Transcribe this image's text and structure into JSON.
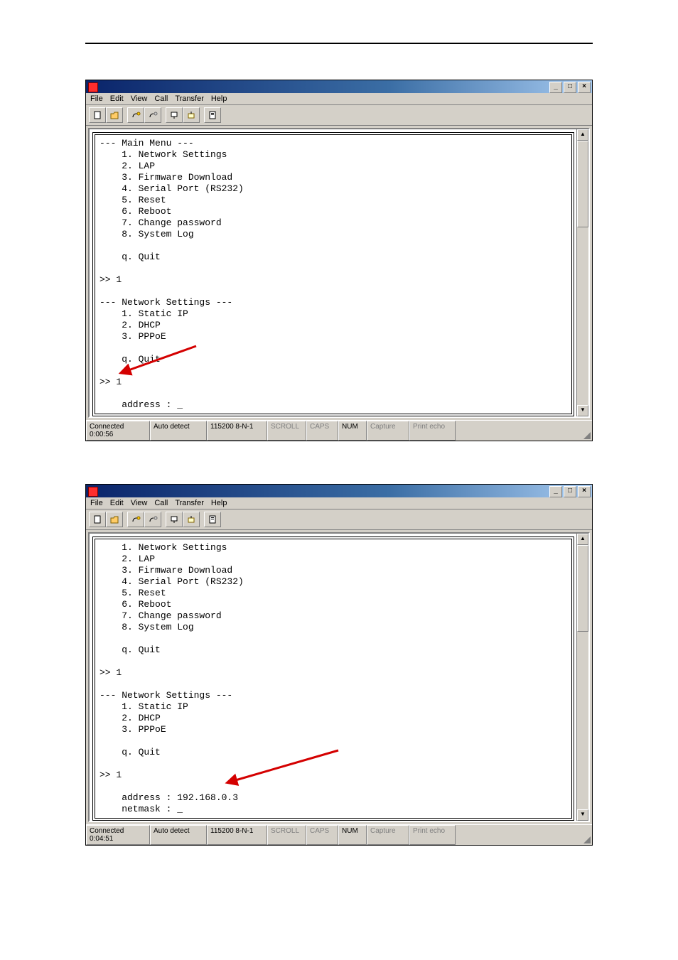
{
  "menu": {
    "file": "File",
    "edit": "Edit",
    "view": "View",
    "call": "Call",
    "transfer": "Transfer",
    "help": "Help"
  },
  "titlebar_controls": {
    "min": "_",
    "max": "□",
    "close": "×"
  },
  "toolbar_icons": [
    "new-file-icon",
    "open-file-icon",
    "connect-icon",
    "disconnect-icon",
    "send-icon",
    "receive-icon",
    "properties-icon"
  ],
  "terminal1": "--- Main Menu ---\n    1. Network Settings\n    2. LAP\n    3. Firmware Download\n    4. Serial Port (RS232)\n    5. Reset\n    6. Reboot\n    7. Change password\n    8. System Log\n\n    q. Quit\n\n>> 1\n\n--- Network Settings ---\n    1. Static IP\n    2. DHCP\n    3. PPPoE\n\n    q. Quit\n\n>> 1\n\n    address : _",
  "terminal2": "    1. Network Settings\n    2. LAP\n    3. Firmware Download\n    4. Serial Port (RS232)\n    5. Reset\n    6. Reboot\n    7. Change password\n    8. System Log\n\n    q. Quit\n\n>> 1\n\n--- Network Settings ---\n    1. Static IP\n    2. DHCP\n    3. PPPoE\n\n    q. Quit\n\n>> 1\n\n    address : 192.168.0.3\n    netmask : _",
  "status1": {
    "conn": "Connected 0:00:56",
    "detect": "Auto detect",
    "port": "115200 8-N-1",
    "scroll": "SCROLL",
    "caps": "CAPS",
    "num": "NUM",
    "capture": "Capture",
    "echo": "Print echo"
  },
  "status2": {
    "conn": "Connected 0:04:51",
    "detect": "Auto detect",
    "port": "115200 8-N-1",
    "scroll": "SCROLL",
    "caps": "CAPS",
    "num": "NUM",
    "capture": "Capture",
    "echo": "Print echo"
  }
}
